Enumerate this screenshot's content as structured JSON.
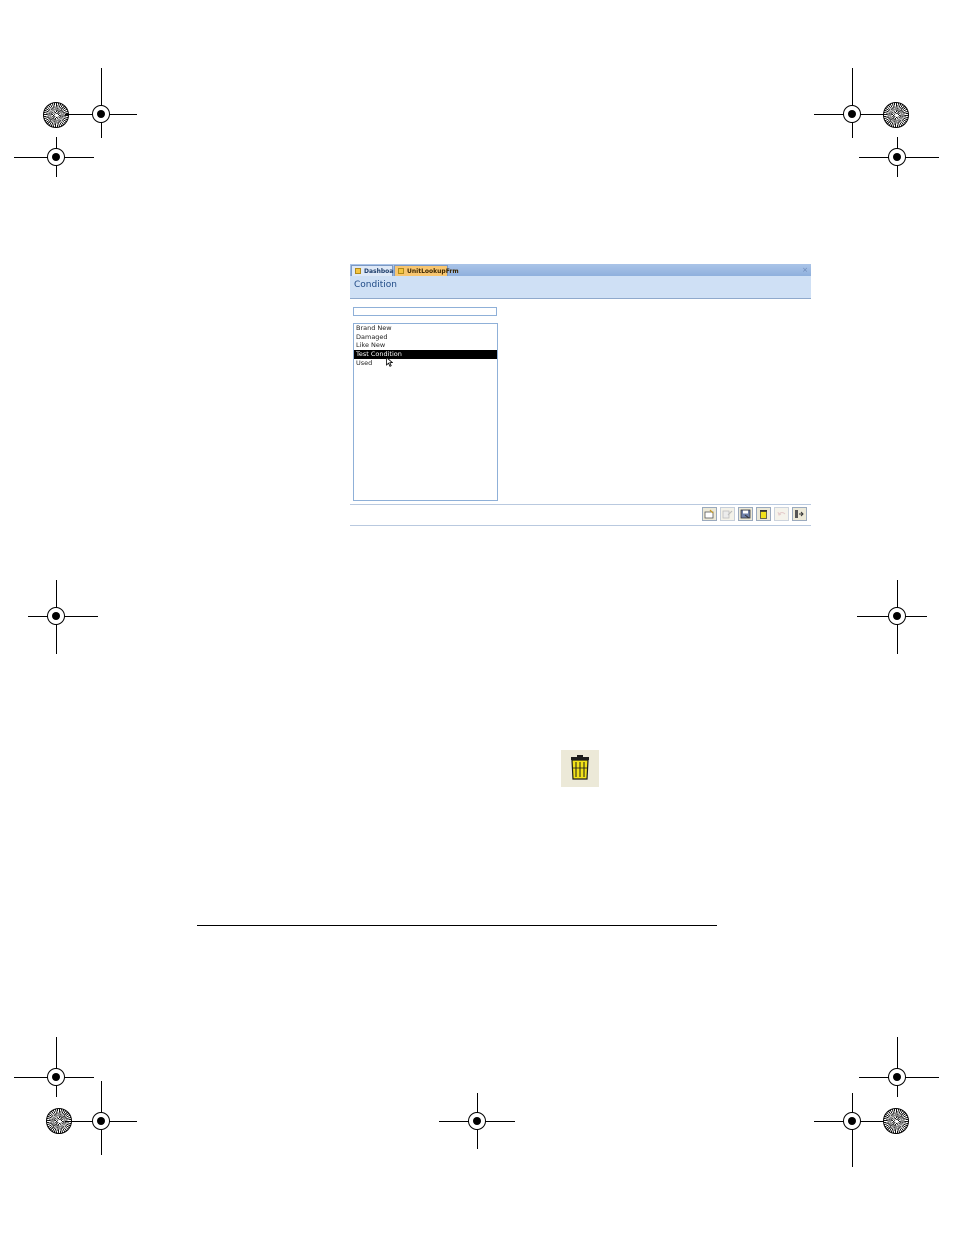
{
  "window": {
    "tabs": [
      {
        "label": "Dashboard",
        "active": false
      },
      {
        "label": "UnitLookupFrm",
        "active": true
      }
    ],
    "close_label": "×",
    "form_title": "Condition"
  },
  "search": {
    "value": ""
  },
  "conditions": {
    "items": [
      "Brand New",
      "Damaged",
      "Like New",
      "Test Condition",
      "Used"
    ],
    "selected": "Test Condition"
  },
  "toolbar": {
    "buttons": [
      {
        "name": "new-record",
        "icon": "new-record-icon"
      },
      {
        "name": "edit-record",
        "icon": "edit-record-icon",
        "enabled": false
      },
      {
        "name": "save-record",
        "icon": "save-record-icon"
      },
      {
        "name": "delete-record",
        "icon": "trash-icon"
      },
      {
        "name": "undo",
        "icon": "undo-icon",
        "enabled": false
      },
      {
        "name": "close-form",
        "icon": "exit-icon"
      }
    ]
  },
  "colors": {
    "tab_active": "#f8c670",
    "header_band": "#cfe0f5",
    "selection": "#000000",
    "trash_yellow": "#f2e21a"
  }
}
